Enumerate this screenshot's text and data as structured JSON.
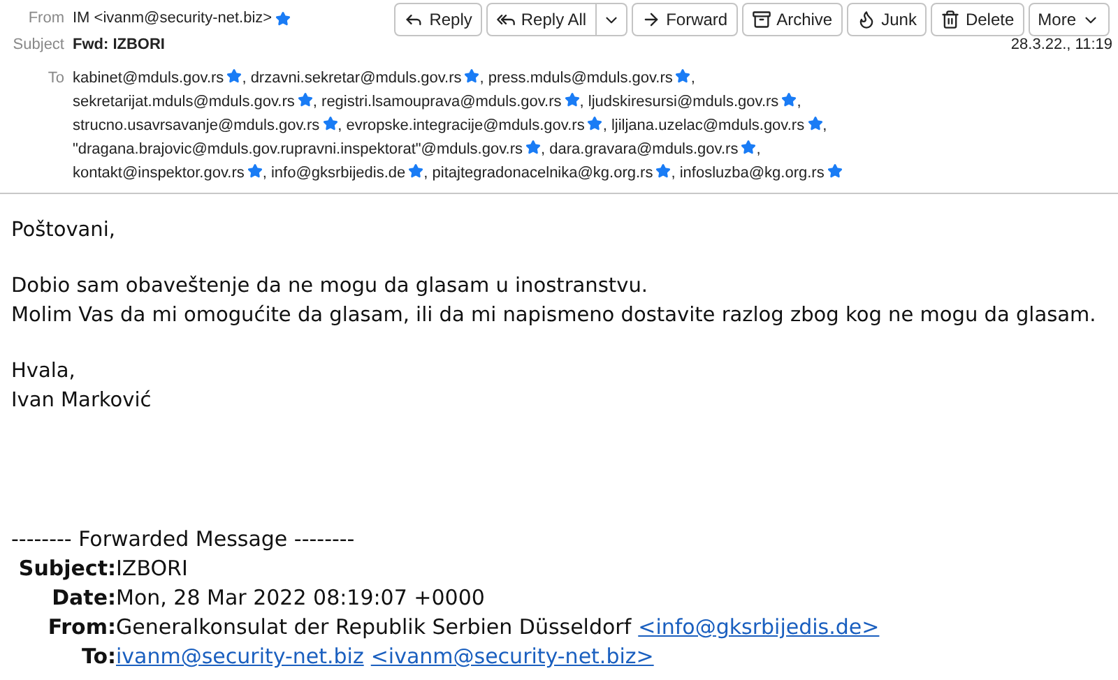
{
  "header": {
    "from_label": "From",
    "from": "IM <ivanm@security-net.biz>",
    "subject_label": "Subject",
    "subject": "Fwd: IZBORI",
    "date": "28.3.22., 11:19",
    "to_label": "To",
    "to": [
      [
        {
          "address": "kabinet@mduls.gov.rs",
          "separator": ","
        },
        {
          "address": "drzavni.sekretar@mduls.gov.rs",
          "separator": ","
        },
        {
          "address": "press.mduls@mduls.gov.rs",
          "separator": ","
        }
      ],
      [
        {
          "address": "sekretarijat.mduls@mduls.gov.rs",
          "separator": ","
        },
        {
          "address": "registri.lsamouprava@mduls.gov.rs",
          "separator": ","
        },
        {
          "address": "ljudskiresursi@mduls.gov.rs",
          "separator": ","
        }
      ],
      [
        {
          "address": "strucno.usavrsavanje@mduls.gov.rs",
          "separator": ","
        },
        {
          "address": "evropske.integracije@mduls.gov.rs",
          "separator": ","
        },
        {
          "address": "ljiljana.uzelac@mduls.gov.rs",
          "separator": ","
        }
      ],
      [
        {
          "address": "\"dragana.brajovic@mduls.gov.rupravni.inspektorat\"@mduls.gov.rs",
          "separator": ","
        },
        {
          "address": "dara.gravara@mduls.gov.rs",
          "separator": ","
        }
      ],
      [
        {
          "address": "kontakt@inspektor.gov.rs",
          "separator": ","
        },
        {
          "address": "info@gksrbijedis.de",
          "separator": ","
        },
        {
          "address": "pitajtegradonacelnika@kg.org.rs",
          "separator": ","
        },
        {
          "address": "infosluzba@kg.org.rs"
        }
      ]
    ]
  },
  "toolbar": [
    {
      "kind": "reply",
      "label": "Reply"
    },
    {
      "kind": "reply_all",
      "label": "Reply All"
    },
    {
      "kind": "forward",
      "label": "Forward"
    },
    {
      "kind": "archive",
      "label": "Archive"
    },
    {
      "kind": "junk",
      "label": "Junk"
    },
    {
      "kind": "delete",
      "label": "Delete"
    },
    {
      "kind": "more",
      "label": "More"
    }
  ],
  "body": {
    "paragraphs": [
      [
        "Poštovani,"
      ],
      [
        "Dobio sam obaveštenje da ne mogu da glasam u inostranstvu.",
        "Molim Vas da mi omogućite da glasam, ili da mi napismeno dostavite razlog zbog kog ne mogu da glasam."
      ],
      [
        "Hvala,",
        "Ivan Marković"
      ]
    ],
    "forwarded": {
      "title": "-------- Forwarded Message --------",
      "fields": [
        {
          "label": "Subject:",
          "parts": [
            {
              "text": "IZBORI",
              "link": false
            }
          ]
        },
        {
          "label": "Date:",
          "parts": [
            {
              "text": "Mon, 28 Mar 2022 08:19:07 +0000",
              "link": false
            }
          ]
        },
        {
          "label": "From:",
          "parts": [
            {
              "text": "Generalkonsulat der Republik Serbien Düsseldorf",
              "link": false
            },
            {
              "text": "<info@gksrbijedis.de>",
              "link": true
            }
          ]
        },
        {
          "label": "To:",
          "parts": [
            {
              "text": "ivanm@security-net.biz",
              "link": true
            },
            {
              "text": "<ivanm@security-net.biz>",
              "link": true
            }
          ]
        }
      ]
    }
  }
}
